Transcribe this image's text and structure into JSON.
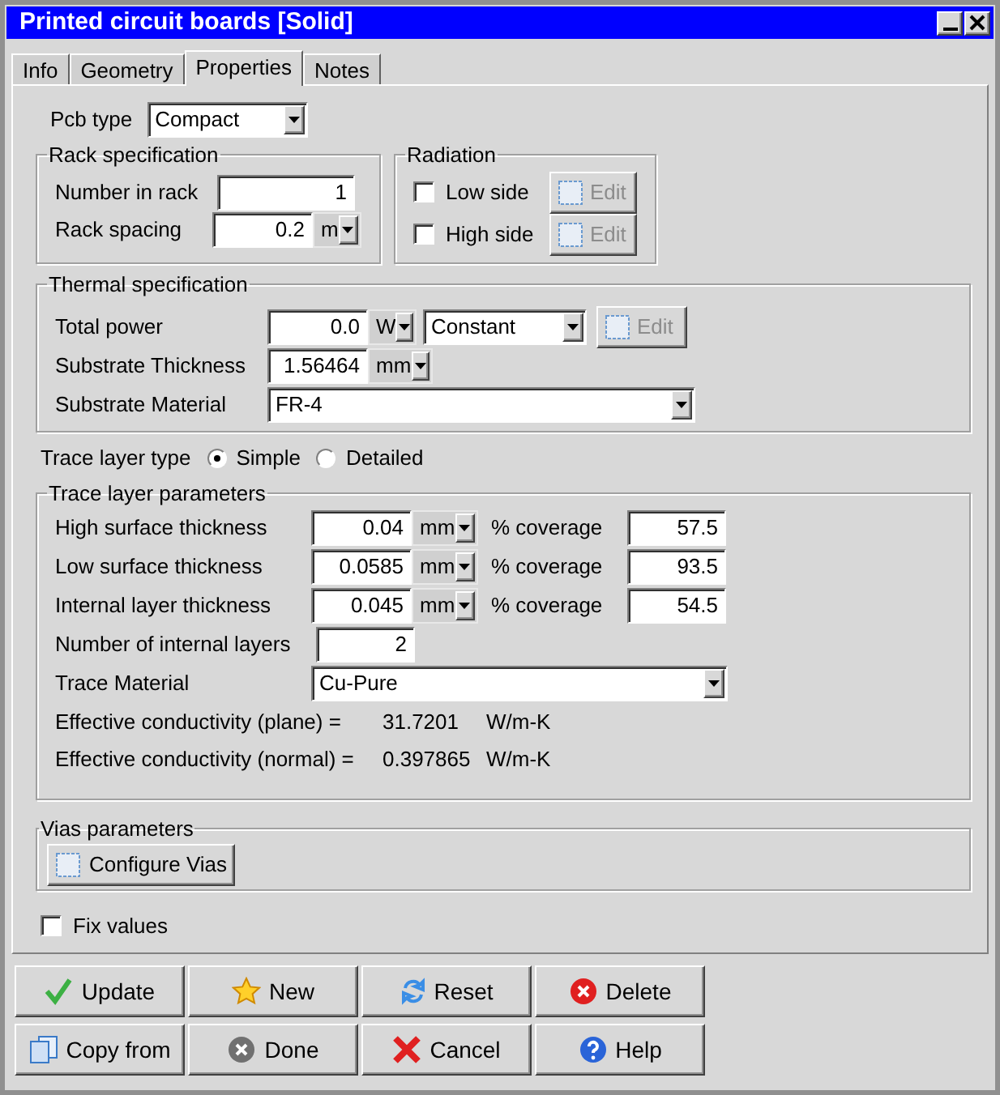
{
  "window": {
    "title": "Printed circuit boards [Solid]"
  },
  "tabs": [
    {
      "label": "Info",
      "selected": false
    },
    {
      "label": "Geometry",
      "selected": false
    },
    {
      "label": "Properties",
      "selected": true
    },
    {
      "label": "Notes",
      "selected": false
    }
  ],
  "pcb_type": {
    "label": "Pcb type",
    "value": "Compact"
  },
  "rack_specification": {
    "title": "Rack specification",
    "number_in_rack": {
      "label": "Number in rack",
      "value": "1"
    },
    "rack_spacing": {
      "label": "Rack spacing",
      "value": "0.2",
      "unit": "m"
    }
  },
  "radiation": {
    "title": "Radiation",
    "options": [
      {
        "label": "Low side",
        "checked": false,
        "button": {
          "label": "Edit",
          "disabled": true
        }
      },
      {
        "label": "High side",
        "checked": false,
        "button": {
          "label": "Edit",
          "disabled": true
        }
      }
    ]
  },
  "thermal_specification": {
    "title": "Thermal specification",
    "total_power": {
      "label": "Total power",
      "value": "0.0",
      "unit": "W",
      "mode": "Constant",
      "button": {
        "label": "Edit",
        "disabled": true
      }
    },
    "substrate_thickness": {
      "label": "Substrate Thickness",
      "value": "1.56464",
      "unit": "mm"
    },
    "substrate_material": {
      "label": "Substrate Material",
      "value": "FR-4"
    }
  },
  "trace_layer_type": {
    "label": "Trace layer type",
    "options": [
      {
        "label": "Simple",
        "selected": true
      },
      {
        "label": "Detailed",
        "selected": false
      }
    ]
  },
  "trace_layer_parameters": {
    "title": "Trace layer parameters",
    "rows": [
      {
        "label": "High surface thickness",
        "value": "0.04",
        "unit": "mm",
        "coverage_label": "% coverage",
        "coverage": "57.5"
      },
      {
        "label": "Low surface thickness",
        "value": "0.0585",
        "unit": "mm",
        "coverage_label": "% coverage",
        "coverage": "93.5"
      },
      {
        "label": "Internal layer thickness",
        "value": "0.045",
        "unit": "mm",
        "coverage_label": "% coverage",
        "coverage": "54.5"
      }
    ],
    "internal_layers": {
      "label": "Number of internal layers",
      "value": "2"
    },
    "trace_material": {
      "label": "Trace Material",
      "value": "Cu-Pure"
    },
    "conductivity": [
      {
        "label": "Effective conductivity (plane) =",
        "value": "31.7201",
        "unit": "W/m-K"
      },
      {
        "label": "Effective conductivity (normal) =",
        "value": "0.397865",
        "unit": "W/m-K"
      }
    ]
  },
  "vias_parameters": {
    "title": "Vias parameters",
    "button": "Configure Vias"
  },
  "fix_values": {
    "label": "Fix values",
    "checked": false
  },
  "buttons": [
    {
      "label": "Update",
      "kind": "check"
    },
    {
      "label": "New",
      "kind": "star"
    },
    {
      "label": "Reset",
      "kind": "reset"
    },
    {
      "label": "Delete",
      "kind": "delete"
    },
    {
      "label": "Copy from",
      "kind": "copy"
    },
    {
      "label": "Done",
      "kind": "done"
    },
    {
      "label": "Cancel",
      "kind": "cancel"
    },
    {
      "label": "Help",
      "kind": "help"
    }
  ]
}
